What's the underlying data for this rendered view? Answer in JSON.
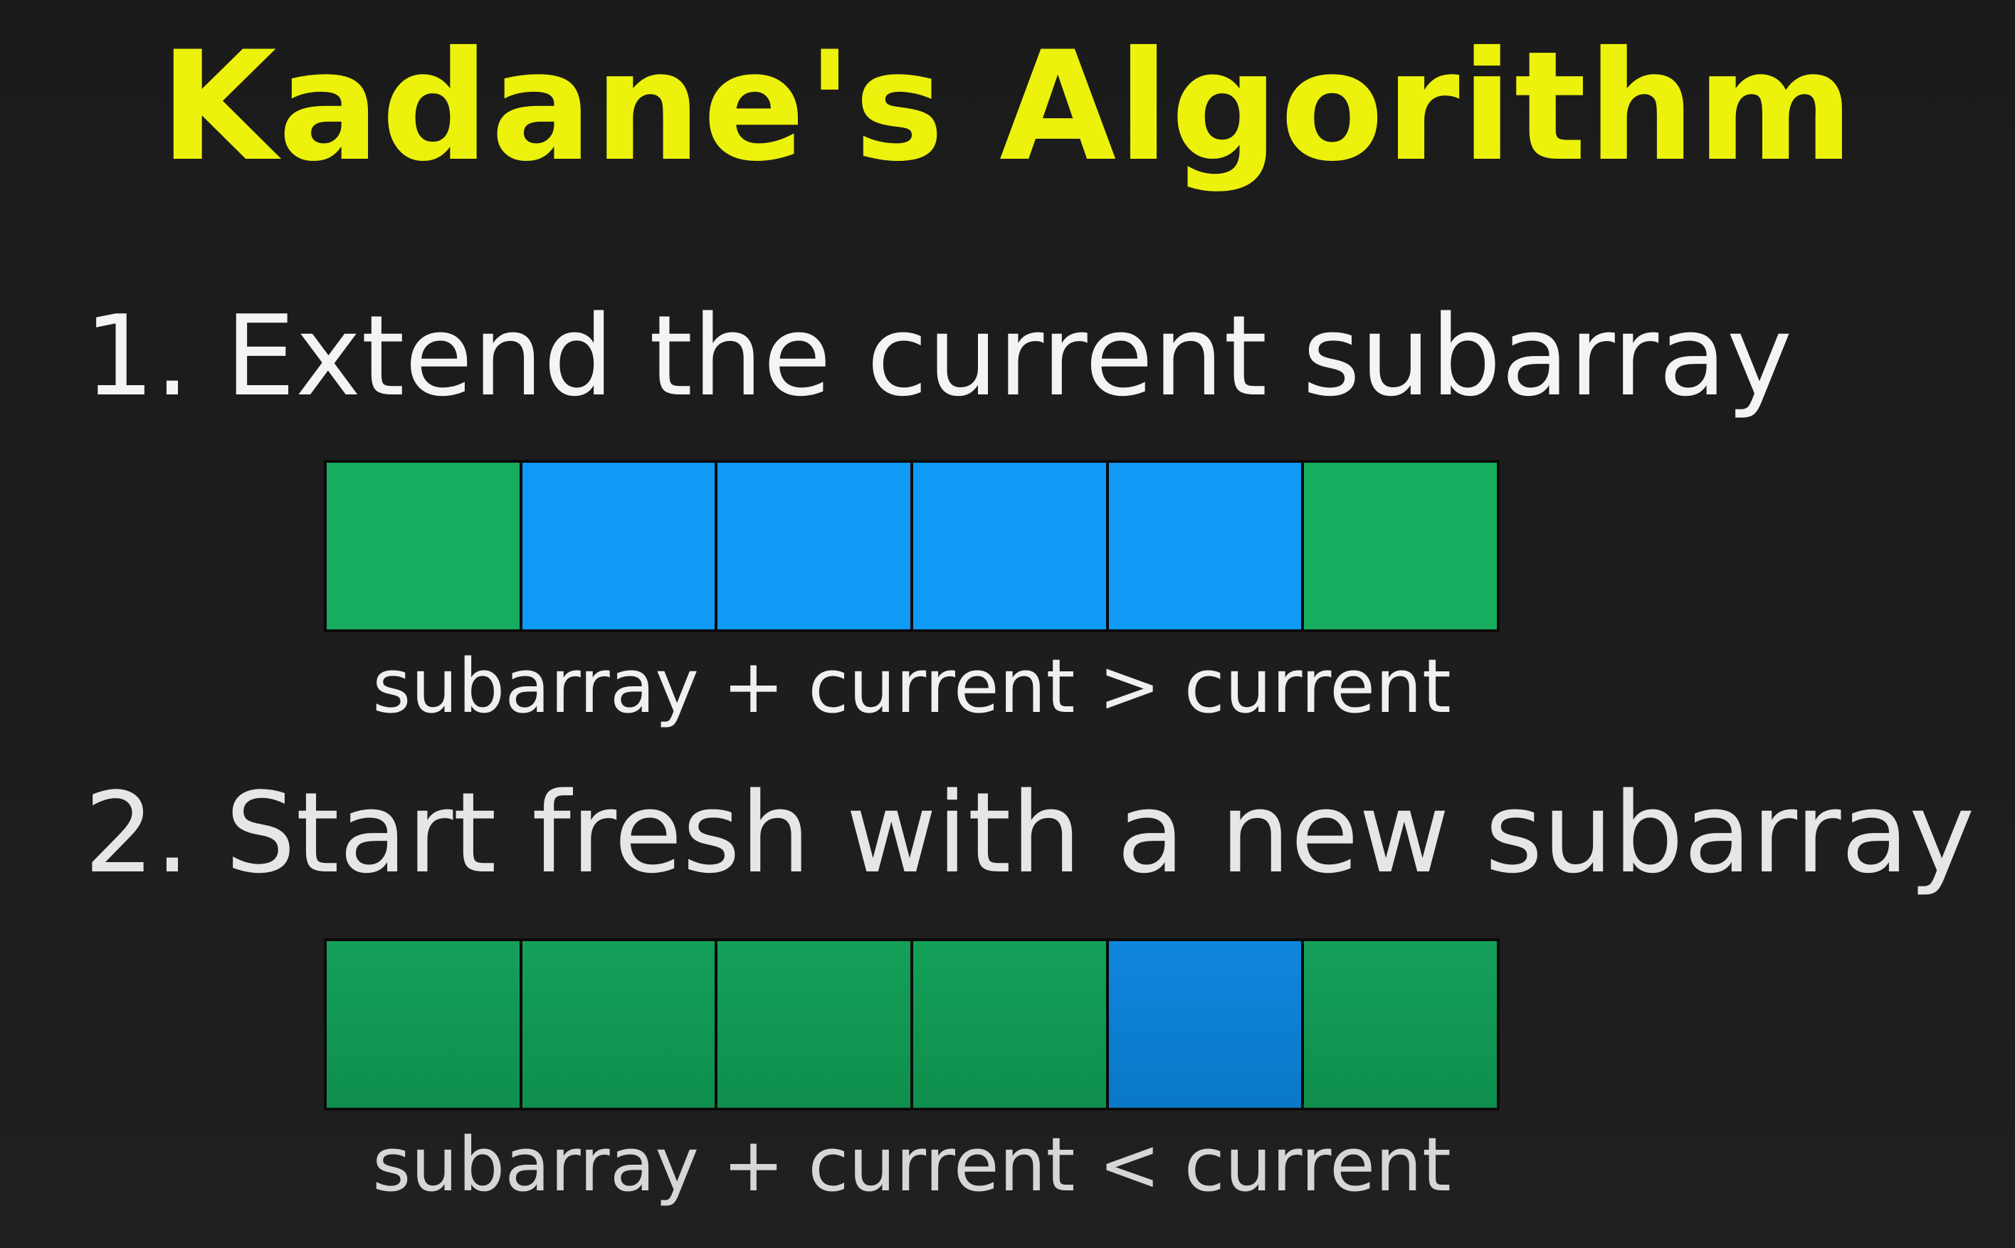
{
  "title": "Kadane's Algorithm",
  "colors": {
    "title": "#ecf20c",
    "background": "#1c1c1c",
    "green_cell": "#16ad5f",
    "blue_cell": "#0f9af5"
  },
  "cases": [
    {
      "heading": "1. Extend the current subarray",
      "cells": [
        "green",
        "blue",
        "blue",
        "blue",
        "blue",
        "green"
      ],
      "caption": "subarray + current > current"
    },
    {
      "heading": "2. Start fresh with a new subarray",
      "cells": [
        "green",
        "green",
        "green",
        "green",
        "blue",
        "green"
      ],
      "caption": "subarray + current < current"
    }
  ]
}
